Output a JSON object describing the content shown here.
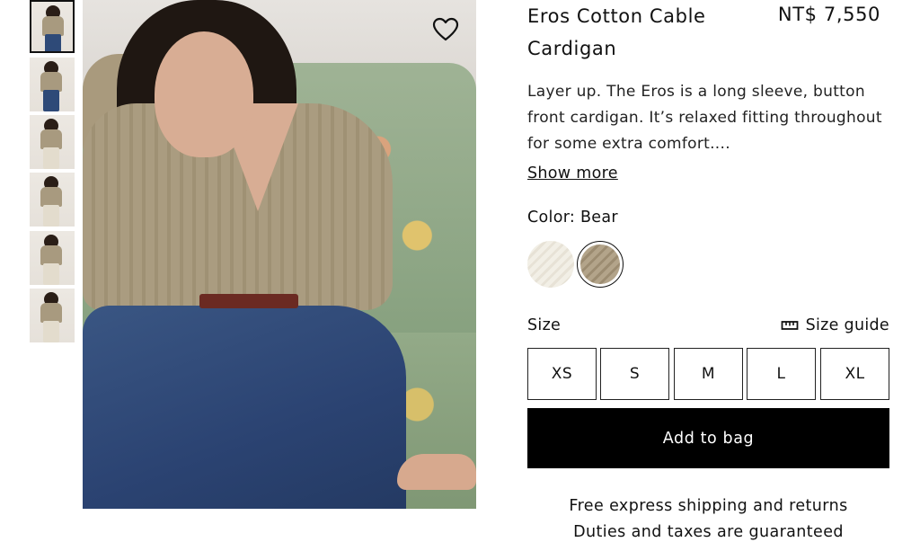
{
  "thumbnails": [
    {
      "name": "thumb-1",
      "active": true
    },
    {
      "name": "thumb-2",
      "active": false
    },
    {
      "name": "thumb-3",
      "active": false
    },
    {
      "name": "thumb-4",
      "active": false
    },
    {
      "name": "thumb-5",
      "active": false
    },
    {
      "name": "thumb-6",
      "active": false
    }
  ],
  "hero": {
    "favorite_icon": "heart-icon"
  },
  "product": {
    "title": "Eros Cotton Cable Cardigan",
    "price": "NT$ 7,550",
    "description": "Layer up. The Eros is a long sleeve, button front cardigan. It’s relaxed fitting throughout for some extra comfort....",
    "show_more": "Show more"
  },
  "color": {
    "label": "Color: Bear",
    "swatches": [
      {
        "name": "ivory",
        "selected": false,
        "hex": "#efebe1"
      },
      {
        "name": "bear",
        "selected": true,
        "hex": "#a99a7e"
      }
    ]
  },
  "size": {
    "label": "Size",
    "guide_label": "Size guide",
    "guide_icon": "ruler-icon",
    "options": [
      "XS",
      "S",
      "M",
      "L",
      "XL"
    ]
  },
  "cta": {
    "add_to_bag": "Add to bag",
    "bg": "#000000",
    "fg": "#ffffff"
  },
  "shipping": {
    "line1": "Free express shipping and returns",
    "line2": "Duties and taxes are guaranteed"
  }
}
